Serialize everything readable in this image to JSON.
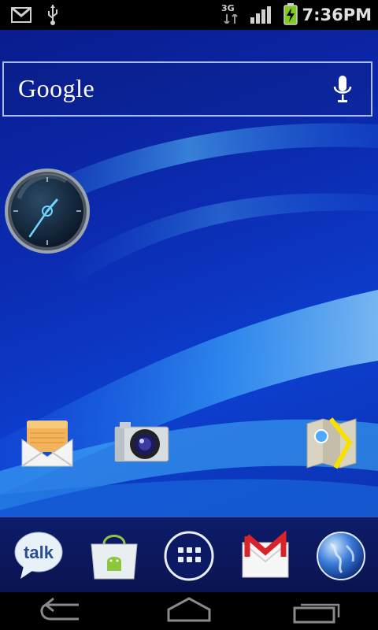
{
  "status_bar": {
    "time": "7:36PM",
    "network": "3G",
    "icons": [
      "gmail-notification-icon",
      "usb-icon",
      "3g-data-icon",
      "signal-icon",
      "battery-charging-icon"
    ]
  },
  "search_widget": {
    "logo_text": "Google",
    "icon": "mic-icon"
  },
  "clock_widget": {
    "type": "analog-clock"
  },
  "desktop_apps": [
    {
      "name": "Email",
      "icon": "email-icon"
    },
    {
      "name": "Camera",
      "icon": "camera-icon"
    },
    {
      "name": "Maps",
      "icon": "maps-icon"
    }
  ],
  "dock": {
    "items": [
      {
        "label": "talk",
        "icon": "talk-icon"
      },
      {
        "name": "Market",
        "icon": "market-icon"
      },
      {
        "name": "Apps",
        "icon": "app-drawer-icon"
      },
      {
        "name": "Gmail",
        "icon": "gmail-icon"
      },
      {
        "name": "Browser",
        "icon": "browser-globe-icon"
      }
    ]
  },
  "nav_bar": {
    "buttons": [
      "back-icon",
      "home-icon",
      "recent-apps-icon"
    ]
  },
  "colors": {
    "wallpaper_dark": "#0a1a8a",
    "wallpaper_light": "#4fb8ff",
    "status_bar": "#000000",
    "battery_green": "#7ecb20"
  }
}
